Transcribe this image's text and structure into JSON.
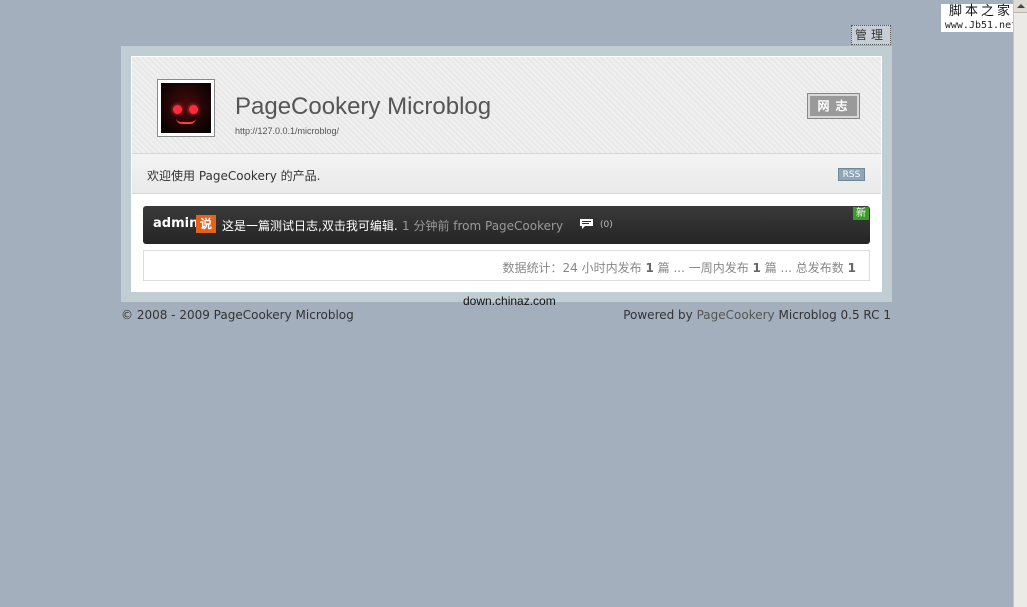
{
  "watermark": {
    "cn": "脚本之家",
    "url": "www.Jb51.net"
  },
  "admin_link": "管理",
  "header": {
    "title": "PageCookery Microblog",
    "url": "http://127.0.0.1/microblog/",
    "nav_button": "网志"
  },
  "welcome": {
    "text": "欢迎使用 PageCookery 的产品.",
    "rss": "RSS"
  },
  "post": {
    "author": "admin",
    "badge": "说",
    "body": "这是一篇测试日志,双击我可编辑.",
    "meta": "1 分钟前 from PageCookery",
    "comment_count": "(0)",
    "new_badge": "新"
  },
  "stats": {
    "prefix": "数据统计：24 小时内发布",
    "day_count": "1",
    "unit1": "篇 ... 一周内发布",
    "week_count": "1",
    "unit2": "篇 ... 总发布数",
    "total_count": "1"
  },
  "mid_watermark": "down.chinaz.com",
  "footer": {
    "copyright": "© 2008 - 2009 PageCookery Microblog",
    "powered_prefix": "Powered by",
    "powered_link": "PageCookery",
    "powered_suffix": "Microblog 0.5 RC 1"
  },
  "colors": {
    "page_bg": "#a3afbc",
    "frame_bg": "#c0cdd3",
    "post_bg": "#2f2f2f",
    "say_badge": "#e4631c",
    "new_badge": "#3c9a2a"
  }
}
